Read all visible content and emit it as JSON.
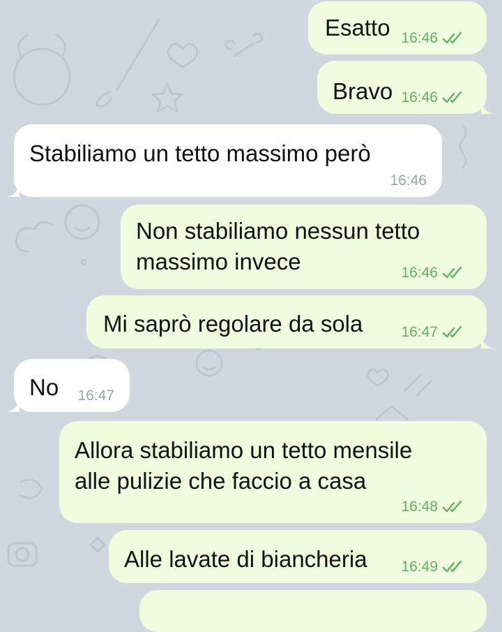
{
  "colors": {
    "background": "#cfd8df",
    "outgoing_bubble": "#effdde",
    "incoming_bubble": "#ffffff",
    "outgoing_time": "#5fb25f",
    "incoming_time": "#9aa3ab"
  },
  "messages": [
    {
      "direction": "outgoing",
      "text": "Esatto",
      "time": "16:46",
      "read": true
    },
    {
      "direction": "outgoing",
      "text": "Bravo",
      "time": "16:46",
      "read": true
    },
    {
      "direction": "incoming",
      "text": "Stabiliamo un tetto massimo però",
      "time": "16:46"
    },
    {
      "direction": "outgoing",
      "text": "Non stabiliamo nessun tetto\nmassimo invece",
      "time": "16:46",
      "read": true
    },
    {
      "direction": "outgoing",
      "text": "Mi saprò regolare da sola",
      "time": "16:47",
      "read": true
    },
    {
      "direction": "incoming",
      "text": "No",
      "time": "16:47"
    },
    {
      "direction": "outgoing",
      "text": "Allora stabiliamo un tetto mensile\nalle pulizie che faccio a casa",
      "time": "16:48",
      "read": true
    },
    {
      "direction": "outgoing",
      "text": "Alle lavate di biancheria",
      "time": "16:49",
      "read": true
    }
  ]
}
